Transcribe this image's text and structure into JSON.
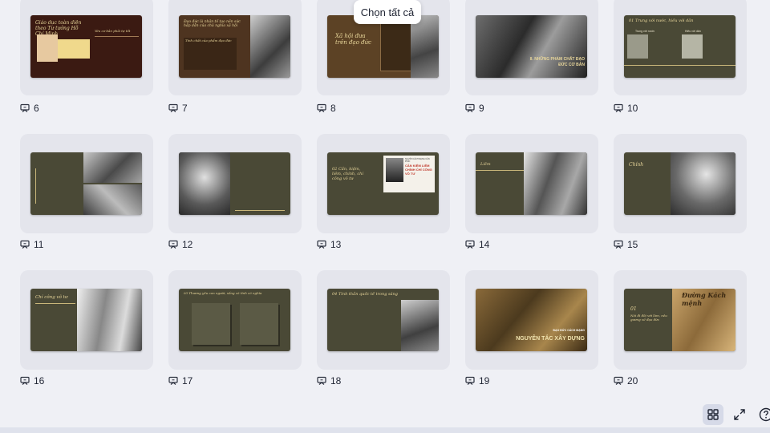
{
  "tooltip": {
    "label": "Chọn tất cả"
  },
  "slides": [
    {
      "number": "6",
      "heading": "Giáo dục toàn diện theo Tư tưởng Hồ Chí Minh",
      "thumb_text": [
        "Yêu cơ bản phải tự tốt"
      ]
    },
    {
      "number": "7",
      "heading": "Đạo đức là nhân tố tạo nên sức hấp dẫn của chủ nghĩa xã hội",
      "thumb_text": [
        "Tính chất của phẩm đạo đức"
      ]
    },
    {
      "number": "8",
      "heading": "Xã hội đưa trên đạo đức",
      "thumb_text": []
    },
    {
      "number": "9",
      "heading": "II. NHỮNG PHẨM CHẤT ĐẠO ĐỨC CƠ BẢN",
      "thumb_text": []
    },
    {
      "number": "10",
      "heading": "01 Trung với nước, hiếu với dân",
      "thumb_text": [
        "Trung với nước",
        "Hiếu với dân"
      ]
    },
    {
      "number": "11",
      "heading": "",
      "thumb_text": []
    },
    {
      "number": "12",
      "heading": "",
      "thumb_text": []
    },
    {
      "number": "13",
      "heading": "02 Cần, kiệm, liêm, chính, chí công vô tư",
      "thumb_text": [
        "NGƯỜI CÁCH MẠNG CẦN PHẢI:",
        "CẦN KIỆM LIÊM CHÍNH CHÍ CÔNG VÔ TƯ"
      ]
    },
    {
      "number": "14",
      "heading": "Liêm",
      "thumb_text": []
    },
    {
      "number": "15",
      "heading": "Chính",
      "thumb_text": []
    },
    {
      "number": "16",
      "heading": "Chí công vô tư",
      "thumb_text": []
    },
    {
      "number": "17",
      "heading": "03 Thương yêu con người, sống có tình có nghĩa",
      "thumb_text": []
    },
    {
      "number": "18",
      "heading": "04 Tinh thần quốc tế trong sáng",
      "thumb_text": []
    },
    {
      "number": "19",
      "heading": "NGUYÊN TẮC XÂY DỰNG",
      "thumb_text": [
        "ĐẠO ĐỨC CÁCH MẠNG"
      ]
    },
    {
      "number": "20",
      "heading": "Đường Kách mệnh",
      "thumb_text": [
        "01",
        "Nói đi đôi với làm, nêu gương về đạo đức"
      ]
    }
  ],
  "toolbar": {
    "grid_view_icon": "grid-view-icon",
    "fullscreen_icon": "fullscreen-icon",
    "help_icon": "help-icon"
  },
  "colors": {
    "background": "#eff0f5",
    "card": "#e4e5ec",
    "slide_olive": "#4a4936",
    "slide_brown": "#5a3b1f",
    "accent_gold": "#e8d69a"
  }
}
